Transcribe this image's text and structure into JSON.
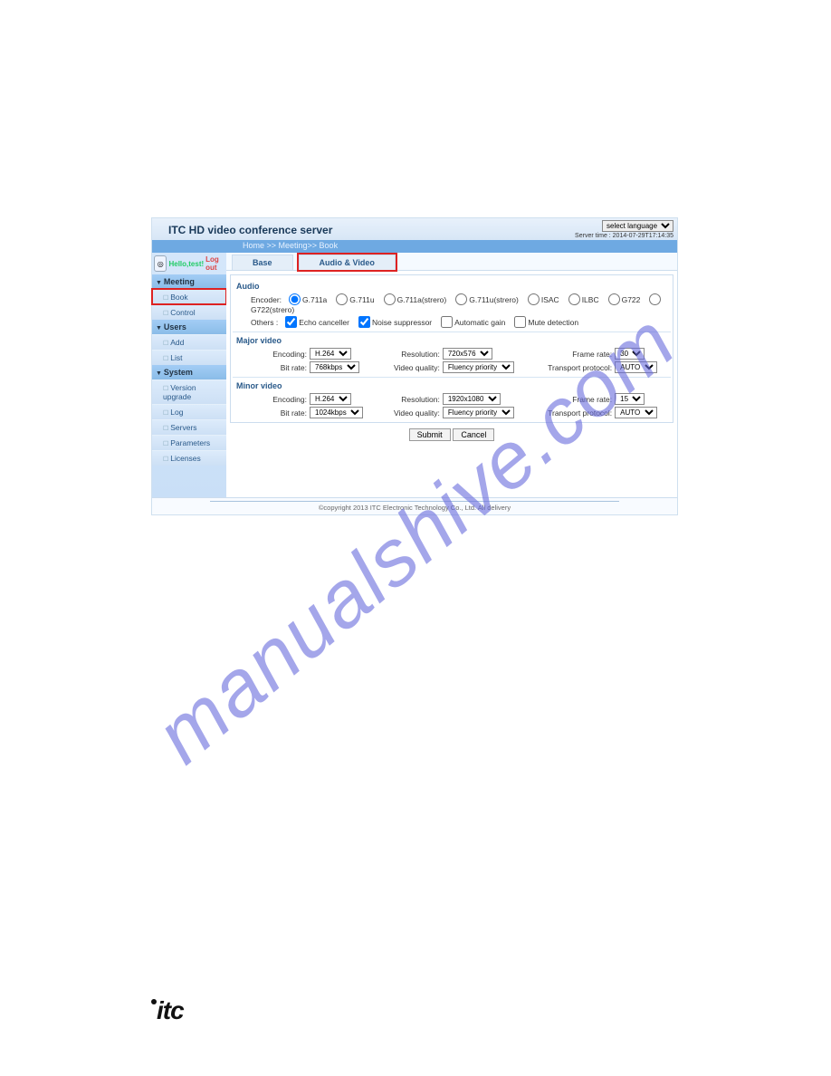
{
  "watermark": "manualshive.com",
  "page_logo": "itc",
  "header": {
    "title": "ITC HD video conference server",
    "language_select": "select language",
    "server_time": "Server time : 2014-07-29T17:14:35"
  },
  "breadcrumb": "Home  >>  Meeting>>  Book",
  "sidebar": {
    "hello": "Hello,test!",
    "logout": "Log out",
    "sections": [
      {
        "label": "Meeting",
        "items": [
          {
            "label": "Book",
            "highlight": true
          },
          {
            "label": "Control"
          }
        ]
      },
      {
        "label": "Users",
        "items": [
          {
            "label": "Add"
          },
          {
            "label": "List"
          }
        ]
      },
      {
        "label": "System",
        "items": [
          {
            "label": "Version upgrade"
          },
          {
            "label": "Log"
          },
          {
            "label": "Servers"
          },
          {
            "label": "Parameters"
          },
          {
            "label": "Licenses"
          }
        ]
      }
    ]
  },
  "tabs": {
    "base": "Base",
    "av": "Audio & Video"
  },
  "audio": {
    "title": "Audio",
    "encoder_label": "Encoder:",
    "encoders": [
      "G.711a",
      "G.711u",
      "G.711a(strero)",
      "G.711u(strero)",
      "ISAC",
      "ILBC",
      "G722",
      "G722(strero)"
    ],
    "encoder_selected": "G.711a",
    "others_label": "Others :",
    "others": [
      {
        "label": "Echo canceller",
        "checked": true
      },
      {
        "label": "Noise suppressor",
        "checked": true
      },
      {
        "label": "Automatic gain",
        "checked": false
      },
      {
        "label": "Mute detection",
        "checked": false
      }
    ]
  },
  "major": {
    "title": "Major video",
    "encoding_label": "Encoding:",
    "encoding": "H.264",
    "resolution_label": "Resolution:",
    "resolution": "720x576",
    "frame_label": "Frame rate:",
    "frame": "30",
    "bitrate_label": "Bit rate:",
    "bitrate": "768kbps",
    "quality_label": "Video quality:",
    "quality": "Fluency priority",
    "transport_label": "Transport protocol:",
    "transport": "AUTO"
  },
  "minor": {
    "title": "Minor video",
    "encoding_label": "Encoding:",
    "encoding": "H.264",
    "resolution_label": "Resolution:",
    "resolution": "1920x1080",
    "frame_label": "Frame rate:",
    "frame": "15",
    "bitrate_label": "Bit rate:",
    "bitrate": "1024kbps",
    "quality_label": "Video quality:",
    "quality": "Fluency priority",
    "transport_label": "Transport protocol:",
    "transport": "AUTO"
  },
  "buttons": {
    "submit": "Submit",
    "cancel": "Cancel"
  },
  "copyright": "©copyright 2013 ITC Electronic Technology Co., Ltd. All delivery"
}
